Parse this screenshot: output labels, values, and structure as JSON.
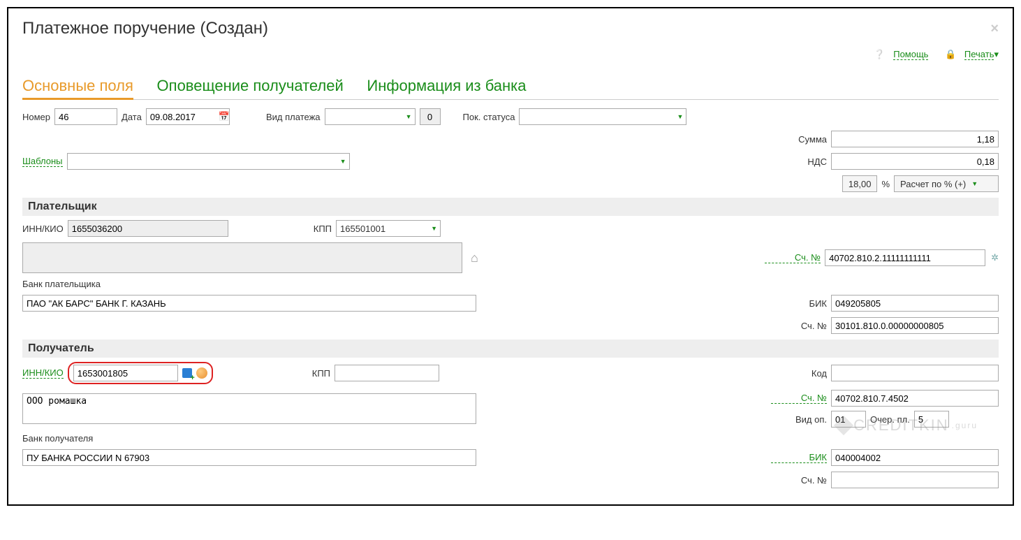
{
  "window": {
    "title": "Платежное поручение (Создан)",
    "close": "×"
  },
  "topLinks": {
    "help": "Помощь",
    "print": "Печать"
  },
  "tabs": {
    "main": "Основные поля",
    "notify": "Оповещение получателей",
    "bankInfo": "Информация из банка"
  },
  "labels": {
    "number": "Номер",
    "date": "Дата",
    "paymentType": "Вид платежа",
    "statusInd": "Пок. статуса",
    "templates": "Шаблоны",
    "sum": "Сумма",
    "vat": "НДС",
    "percent": "%",
    "vatCalc": "Расчет по % (+)",
    "payer": "Плательщик",
    "innKio": "ИНН/КИО",
    "kpp": "КПП",
    "accountNo": "Сч. №",
    "payerBank": "Банк плательщика",
    "bik": "БИК",
    "recipient": "Получатель",
    "recipientBank": "Банк получателя",
    "code": "Код",
    "operType": "Вид оп.",
    "queue": "Очер. пл."
  },
  "fields": {
    "number": "46",
    "date": "09.08.2017",
    "paymentTypeCode": "0",
    "sum": "1,18",
    "vat": "0,18",
    "vatRate": "18,00",
    "payerInn": "1655036200",
    "payerKpp": "165501001",
    "payerAccount": "40702.810.2.11111111111",
    "payerBank": "ПАО \"АК БАРС\" БАНК Г. КАЗАНЬ",
    "payerBik": "049205805",
    "payerCorrAccount": "30101.810.0.00000000805",
    "recipInn": "1653001805",
    "recipKpp": "",
    "recipName": "ООО ромашка",
    "recipCode": "",
    "recipAccount": "40702.810.7.4502",
    "operType": "01",
    "queue": "5",
    "recipBank": "ПУ БАНКА РОССИИ N 67903",
    "recipBik": "040004002",
    "recipCorrAccount": ""
  },
  "watermark": "CREDITKIN"
}
